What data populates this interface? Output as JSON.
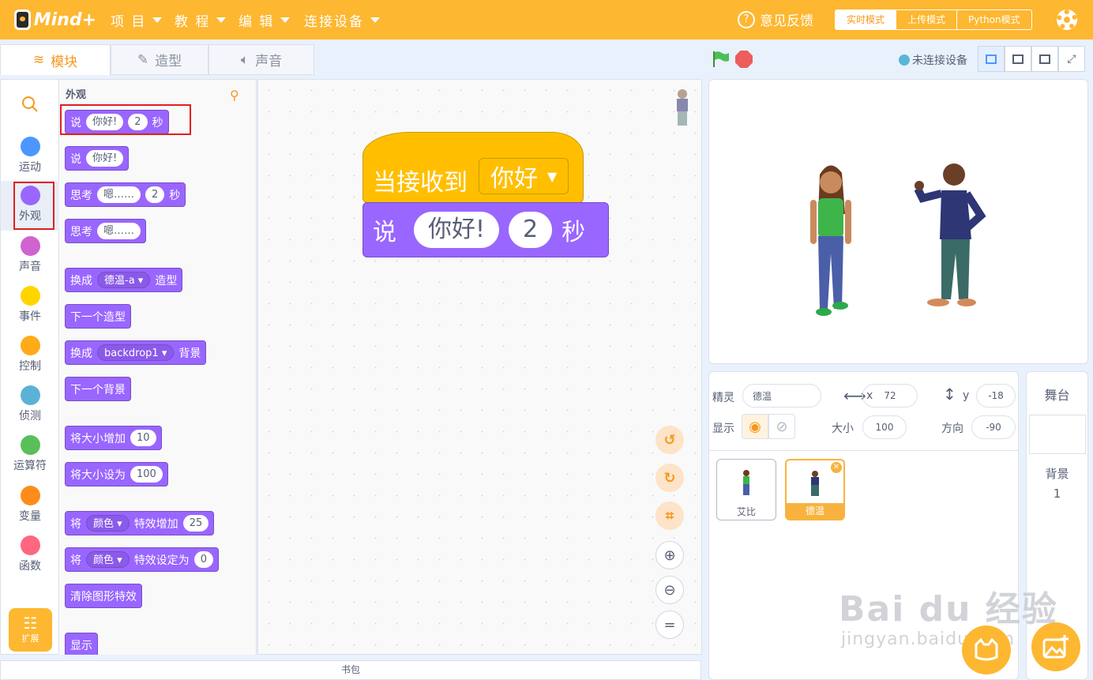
{
  "app": {
    "name": "Mind+"
  },
  "menu": [
    {
      "label": "项 目"
    },
    {
      "label": "教 程"
    },
    {
      "label": "编 辑"
    },
    {
      "label": "连接设备"
    }
  ],
  "header": {
    "feedback": "意见反馈",
    "modes": [
      "实时模式",
      "上传模式",
      "Python模式"
    ]
  },
  "tabs": [
    "模块",
    "造型",
    "声音"
  ],
  "device": {
    "status": "未连接设备"
  },
  "categories": [
    "运动",
    "外观",
    "声音",
    "事件",
    "控制",
    "侦测",
    "运算符",
    "变量",
    "函数"
  ],
  "category_colors": [
    "#4c97ff",
    "#9966ff",
    "#cf63cf",
    "#ffd500",
    "#ffab19",
    "#5cb1d6",
    "#59c059",
    "#ff8c1a",
    "#ff6680"
  ],
  "extensions": {
    "label": "扩展"
  },
  "palette": {
    "section": "外观",
    "b1": {
      "a": "说",
      "b": "你好!",
      "c": "2",
      "d": "秒"
    },
    "b2": {
      "a": "说",
      "b": "你好!"
    },
    "b3": {
      "a": "思考",
      "b": "嗯……",
      "c": "2",
      "d": "秒"
    },
    "b4": {
      "a": "思考",
      "b": "嗯……"
    },
    "b5": {
      "a": "换成",
      "b": "德温-a",
      "c": "造型"
    },
    "b6": {
      "a": "下一个造型"
    },
    "b7": {
      "a": "换成",
      "b": "backdrop1",
      "c": "背景"
    },
    "b8": {
      "a": "下一个背景"
    },
    "b9": {
      "a": "将大小增加",
      "b": "10"
    },
    "b10": {
      "a": "将大小设为",
      "b": "100"
    },
    "b11": {
      "a": "将",
      "b": "颜色",
      "c": "特效增加",
      "d": "25"
    },
    "b12": {
      "a": "将",
      "b": "颜色",
      "c": "特效设定为",
      "d": "0"
    },
    "b13": {
      "a": "清除图形特效"
    },
    "b14": {
      "a": "显示"
    }
  },
  "script": {
    "hat_label": "当接收到",
    "hat_value": "你好",
    "say_label": "说",
    "say_text": "你好!",
    "say_secs": "2",
    "say_unit": "秒"
  },
  "sprite": {
    "label": "精灵",
    "name": "德温",
    "x_label": "x",
    "x": "72",
    "y_label": "y",
    "y": "-18",
    "show_label": "显示",
    "size_label": "大小",
    "size": "100",
    "dir_label": "方向",
    "direction": "-90"
  },
  "sprites": [
    "艾比",
    "德温"
  ],
  "stage_panel": {
    "title": "舞台",
    "backdrop_label": "背景",
    "backdrop_count": "1"
  },
  "backpack": "书包",
  "watermark": {
    "brand": "Bai du 经验",
    "url": "jingyan.baidu.com"
  },
  "colors": {
    "accent": "#fdb731",
    "looks": "#9966ff",
    "events": "#ffbf00",
    "highlight": "#e02020"
  }
}
